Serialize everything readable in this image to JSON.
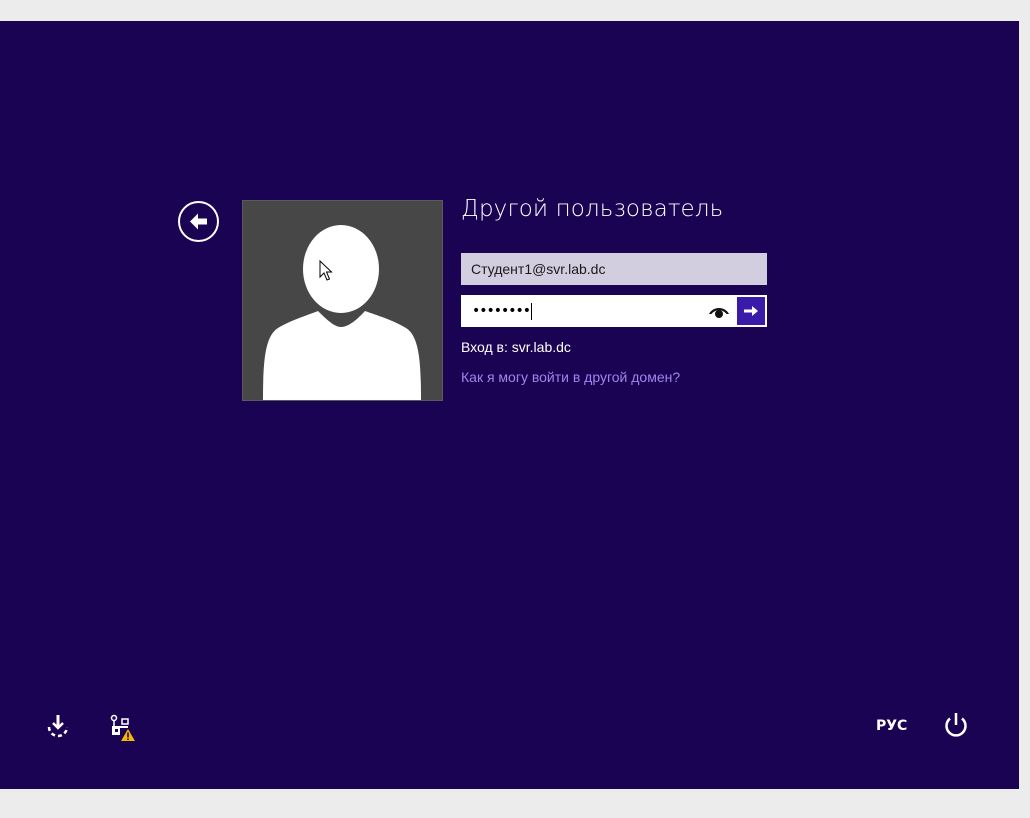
{
  "login": {
    "title": "Другой пользователь",
    "username_value": "Студент1@svr.lab.dc",
    "password_masked": "••••••••",
    "domain_label": "Вход в: svr.lab.dc",
    "other_domain_link": "Как я могу войти в другой домен?"
  },
  "footer": {
    "language": "РУС"
  },
  "colors": {
    "background": "#1b0353",
    "accent": "#3a1aa8",
    "link": "#9f86ee",
    "warning": "#f5b800"
  },
  "icons": {
    "back": "back-arrow-icon",
    "reveal": "eye-icon",
    "submit": "arrow-right-icon",
    "ease_of_access": "ease-of-access-icon",
    "network": "network-warning-icon",
    "power": "power-icon"
  }
}
